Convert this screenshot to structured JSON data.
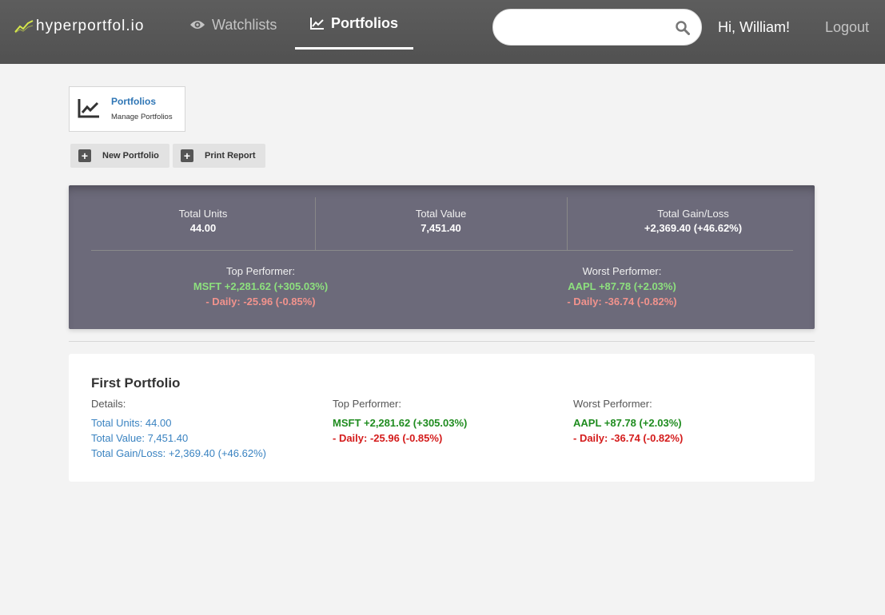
{
  "brand": {
    "name": "hyperportfol.io",
    "logo_icon": "trend-line-icon"
  },
  "nav": {
    "watchlists_label": "Watchlists",
    "watchlists_icon": "eye-icon",
    "portfolios_label": "Portfolios",
    "portfolios_icon": "area-chart-icon",
    "active": "Portfolios"
  },
  "search": {
    "value": "",
    "placeholder": "",
    "icon": "search-icon"
  },
  "user": {
    "greeting": "Hi, William!",
    "logout_label": "Logout"
  },
  "section": {
    "title": "Portfolios",
    "subtitle": "Manage Portfolios",
    "icon": "line-chart-icon"
  },
  "actions": {
    "new_label": "New Portfolio",
    "print_label": "Print Report"
  },
  "summary": {
    "units_label": "Total Units",
    "units_value": "44.00",
    "value_label": "Total Value",
    "value_value": "7,451.40",
    "gain_label": "Total Gain/Loss",
    "gain_value": "+2,369.40 (+46.62%)",
    "top_label": "Top Performer:",
    "top_value": "MSFT +2,281.62 (+305.03%)",
    "top_daily": "- Daily: -25.96 (-0.85%)",
    "worst_label": "Worst Performer:",
    "worst_value": "AAPL +87.78 (+2.03%)",
    "worst_daily": "- Daily: -36.74 (-0.82%)"
  },
  "portfolios": [
    {
      "name": "First Portfolio",
      "details_label": "Details:",
      "units": "Total Units: 44.00",
      "value": "Total Value: 7,451.40",
      "gain": "Total Gain/Loss: +2,369.40 (+46.62%)",
      "top_label": "Top Performer:",
      "top_value": "MSFT +2,281.62 (+305.03%)",
      "top_daily": "- Daily: -25.96 (-0.85%)",
      "worst_label": "Worst Performer:",
      "worst_value": "AAPL +87.78 (+2.03%)",
      "worst_daily": "- Daily: -36.74 (-0.82%)"
    }
  ],
  "colors": {
    "navbar": "#555555",
    "summary_bg": "#6c6a7a",
    "link": "#3a83c1",
    "gain": "#1f8c1f",
    "loss": "#d41c1c",
    "gain_light": "#8de07e",
    "loss_light": "#f2938d"
  }
}
